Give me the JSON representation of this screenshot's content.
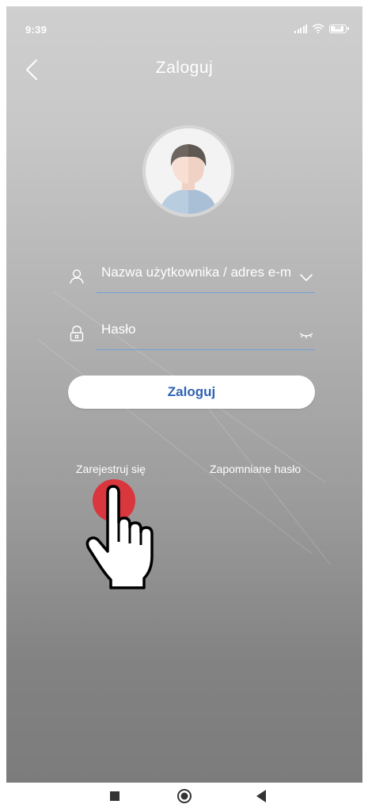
{
  "status_bar": {
    "time": "9:39",
    "battery_level": "88"
  },
  "header": {
    "title": "Zaloguj",
    "back_icon": "chevron-left-icon"
  },
  "form": {
    "username": {
      "icon": "user-icon",
      "value": "Nazwa użytkownika / adres e-m",
      "trailing_icon": "chevron-down-icon"
    },
    "password": {
      "icon": "lock-icon",
      "value": "Hasło",
      "trailing_icon": "eye-closed-icon"
    },
    "login_label": "Zaloguj"
  },
  "links": {
    "register": "Zarejestruj się",
    "forgot_password": "Zapomniane hasło"
  },
  "overlay": {
    "icon": "pointing-hand-icon",
    "accent_color": "#d9363e"
  },
  "colors": {
    "accent": "#2f63b5",
    "underline": "#6f9fd6"
  },
  "nav": {
    "icons": [
      "square-recents-icon",
      "circle-home-icon",
      "triangle-back-icon"
    ]
  }
}
